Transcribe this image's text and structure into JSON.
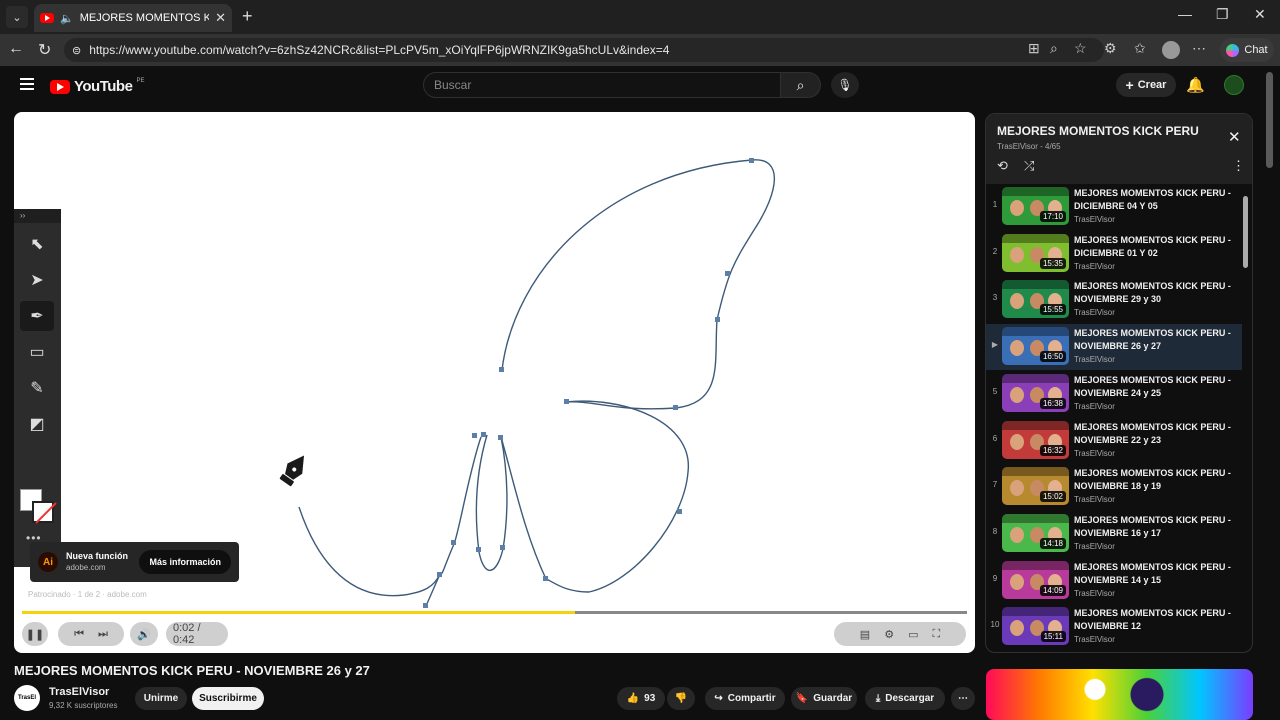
{
  "browser": {
    "tab_title": "MEJORES MOMENTOS KICK P",
    "url": "https://www.youtube.com/watch?v=6zhSz42NCRc&list=PLcPV5m_xOiYqlFP6jpWRNZIK9ga5hcULv&index=4",
    "chat_label": "Chat"
  },
  "header": {
    "logo_text": "YouTube",
    "country_code": "PE",
    "search_placeholder": "Buscar",
    "create_label": "Crear"
  },
  "video": {
    "ad_title": "Nueva función",
    "ad_domain": "adobe.com",
    "ad_button": "Más información",
    "ad_logo": "Ai",
    "sponsor_text": "Patrocinado · 1 de 2 · adobe.com",
    "progress_fraction": 0.585,
    "time": "0:02 / 0:42",
    "title": "MEJORES MOMENTOS KICK PERU - NOVIEMBRE 26 y 27"
  },
  "channel": {
    "name": "TrasElVisor",
    "subscribers": "9,32 K suscriptores",
    "join_label": "Unirme",
    "subscribe_label": "Suscribirme"
  },
  "actions": {
    "likes": "93",
    "share_label": "Compartir",
    "save_label": "Guardar",
    "download_label": "Descargar"
  },
  "playlist": {
    "title": "MEJORES MOMENTOS KICK PERU",
    "subtitle": "TrasElVisor - 4/65",
    "items": [
      {
        "num": "1",
        "title": "MEJORES MOMENTOS KICK PERU - DICIEMBRE 04 Y 05",
        "channel": "TrasElVisor",
        "duration": "17:10",
        "color": "#2f9a3a"
      },
      {
        "num": "2",
        "title": "MEJORES MOMENTOS KICK PERU - DICIEMBRE 01 Y 02",
        "channel": "TrasElVisor",
        "duration": "15:35",
        "color": "#7fbf2f"
      },
      {
        "num": "3",
        "title": "MEJORES MOMENTOS KICK PERU - NOVIEMBRE 29 y 30",
        "channel": "TrasElVisor",
        "duration": "15:55",
        "color": "#1f8a4a"
      },
      {
        "num": "▶",
        "title": "MEJORES MOMENTOS KICK PERU - NOVIEMBRE 26 y 27",
        "channel": "TrasElVisor",
        "duration": "16:50",
        "color": "#3a6fb8"
      },
      {
        "num": "5",
        "title": "MEJORES MOMENTOS KICK PERU - NOVIEMBRE 24 y 25",
        "channel": "TrasElVisor",
        "duration": "16:38",
        "color": "#8a3fb8"
      },
      {
        "num": "6",
        "title": "MEJORES MOMENTOS KICK PERU - NOVIEMBRE 22 y 23",
        "channel": "TrasElVisor",
        "duration": "16:32",
        "color": "#c23a3a"
      },
      {
        "num": "7",
        "title": "MEJORES MOMENTOS KICK PERU - NOVIEMBRE 18 y 19",
        "channel": "TrasElVisor",
        "duration": "15:02",
        "color": "#b88a2f"
      },
      {
        "num": "8",
        "title": "MEJORES MOMENTOS KICK PERU - NOVIEMBRE 16 y 17",
        "channel": "TrasElVisor",
        "duration": "14:18",
        "color": "#4ab84a"
      },
      {
        "num": "9",
        "title": "MEJORES MOMENTOS KICK PERU - NOVIEMBRE 14 y 15",
        "channel": "TrasElVisor",
        "duration": "14:09",
        "color": "#b83a9a"
      },
      {
        "num": "10",
        "title": "MEJORES MOMENTOS KICK PERU - NOVIEMBRE 12",
        "channel": "TrasElVisor",
        "duration": "15:11",
        "color": "#6a3ab8"
      }
    ]
  },
  "colors": {
    "accent": "#ff0000",
    "progress": "#f5d20a",
    "path_stroke": "#3d5a78"
  }
}
